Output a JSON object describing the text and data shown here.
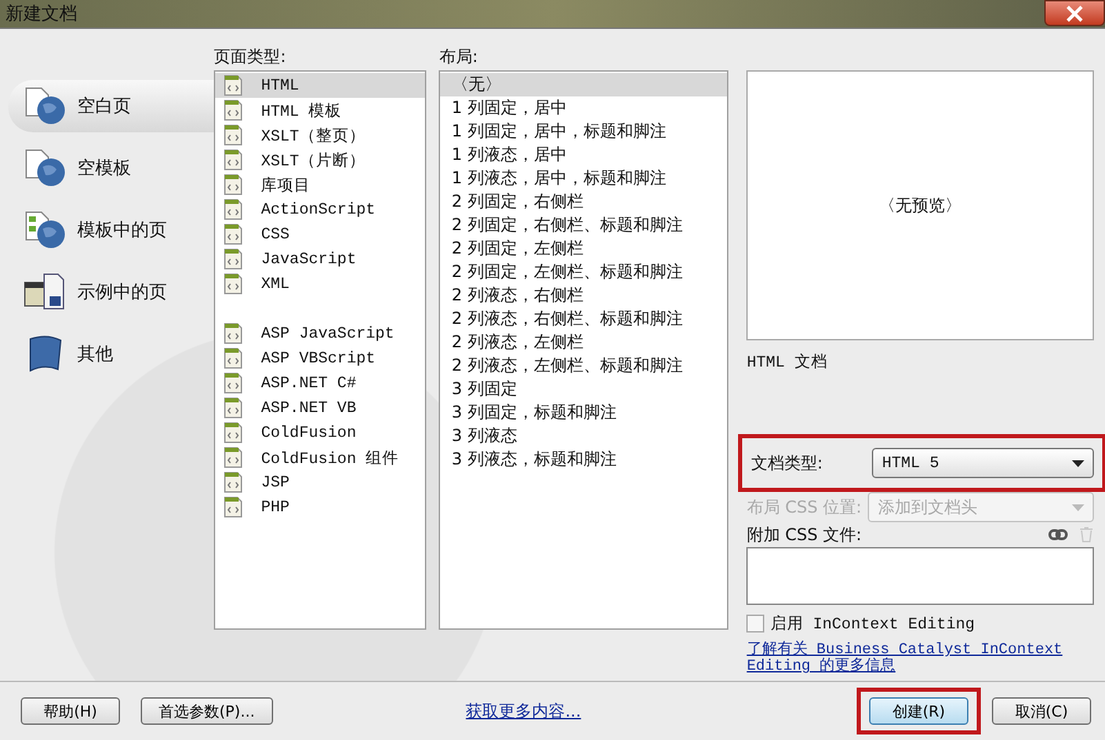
{
  "window": {
    "title": "新建文档"
  },
  "categories": [
    {
      "label": "空白页",
      "kind": "blank",
      "selected": true
    },
    {
      "label": "空模板",
      "kind": "blank",
      "selected": false
    },
    {
      "label": "模板中的页",
      "kind": "template",
      "selected": false
    },
    {
      "label": "示例中的页",
      "kind": "sample",
      "selected": false
    },
    {
      "label": "其他",
      "kind": "other",
      "selected": false
    }
  ],
  "page_types": {
    "label": "页面类型:",
    "groups": [
      {
        "items": [
          {
            "label": "HTML",
            "selected": true
          },
          {
            "label": "HTML 模板",
            "selected": false
          },
          {
            "label": "XSLT（整页）",
            "selected": false
          },
          {
            "label": "XSLT（片断）",
            "selected": false
          },
          {
            "label": "库项目",
            "selected": false
          },
          {
            "label": "ActionScript",
            "selected": false
          },
          {
            "label": "CSS",
            "selected": false
          },
          {
            "label": "JavaScript",
            "selected": false
          },
          {
            "label": "XML",
            "selected": false
          }
        ]
      },
      {
        "items": [
          {
            "label": "ASP JavaScript",
            "selected": false
          },
          {
            "label": "ASP VBScript",
            "selected": false
          },
          {
            "label": "ASP.NET C#",
            "selected": false
          },
          {
            "label": "ASP.NET VB",
            "selected": false
          },
          {
            "label": "ColdFusion",
            "selected": false
          },
          {
            "label": "ColdFusion 组件",
            "selected": false
          },
          {
            "label": "JSP",
            "selected": false
          },
          {
            "label": "PHP",
            "selected": false
          }
        ]
      }
    ]
  },
  "layouts": {
    "label": "布局:",
    "items": [
      {
        "label": "〈无〉",
        "selected": true
      },
      {
        "label": "1 列固定，居中",
        "selected": false
      },
      {
        "label": "1 列固定，居中，标题和脚注",
        "selected": false
      },
      {
        "label": "1 列液态，居中",
        "selected": false
      },
      {
        "label": "1 列液态，居中，标题和脚注",
        "selected": false
      },
      {
        "label": "2 列固定，右侧栏",
        "selected": false
      },
      {
        "label": "2 列固定，右侧栏、标题和脚注",
        "selected": false
      },
      {
        "label": "2 列固定，左侧栏",
        "selected": false
      },
      {
        "label": "2 列固定，左侧栏、标题和脚注",
        "selected": false
      },
      {
        "label": "2 列液态，右侧栏",
        "selected": false
      },
      {
        "label": "2 列液态，右侧栏、标题和脚注",
        "selected": false
      },
      {
        "label": "2 列液态，左侧栏",
        "selected": false
      },
      {
        "label": "2 列液态，左侧栏、标题和脚注",
        "selected": false
      },
      {
        "label": "3 列固定",
        "selected": false
      },
      {
        "label": "3 列固定，标题和脚注",
        "selected": false
      },
      {
        "label": "3 列液态",
        "selected": false
      },
      {
        "label": "3 列液态，标题和脚注",
        "selected": false
      }
    ]
  },
  "preview": {
    "text": "〈无预览〉",
    "description": "HTML 文档"
  },
  "doc_type": {
    "label": "文档类型:",
    "value": "HTML 5",
    "highlighted": true
  },
  "layout_css": {
    "label": "布局 CSS 位置:",
    "value": "添加到文档头",
    "disabled": true
  },
  "attach_css": {
    "label": "附加 CSS 文件:",
    "trash_disabled": true
  },
  "incontext": {
    "label": "启用 InContext Editing",
    "checked": false
  },
  "learn_link": "了解有关 Business Catalyst InContext Editing 的更多信息",
  "footer": {
    "help": "帮助(H)",
    "prefs": "首选参数(P)...",
    "more": "获取更多内容...",
    "create": {
      "label": "创建(R)",
      "highlighted": true
    },
    "cancel": "取消(C)"
  }
}
